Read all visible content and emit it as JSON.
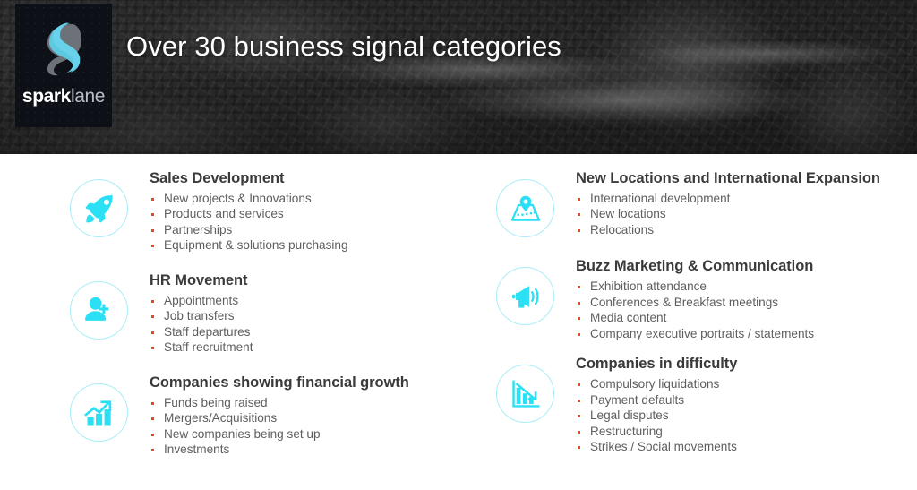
{
  "header": {
    "title": "Over 30 business signal categories",
    "logo": {
      "mark": "spark-s-monogram",
      "word_bold": "spark",
      "word_light": "lane"
    },
    "background_image": "aerial-city-highway-interchange-grayscale"
  },
  "theme": {
    "icon_cyan": "#2BE0F5",
    "icon_circle_border": "#A8EEF8",
    "bullet_marker": "#E8491E",
    "heading_text": "#3A3A3A",
    "body_text": "#5E5E5E",
    "banner_dark": "#0D1117"
  },
  "columns": {
    "left": [
      {
        "icon": "rocket-icon",
        "title": "Sales Development",
        "bullets": [
          "New projects & Innovations",
          "Products and services",
          "Partnerships",
          "Equipment & solutions purchasing"
        ]
      },
      {
        "icon": "user-plus-icon",
        "title": "HR Movement",
        "bullets": [
          "Appointments",
          "Job transfers",
          "Staff departures",
          "Staff recruitment"
        ]
      },
      {
        "icon": "growth-chart-icon",
        "title": "Companies showing financial growth",
        "bullets": [
          "Funds being raised",
          "Mergers/Acquisitions",
          "New companies being set up",
          "Investments"
        ]
      }
    ],
    "right": [
      {
        "icon": "map-pin-icon",
        "title": "New Locations and International Expansion",
        "bullets": [
          "International development",
          "New locations",
          "Relocations"
        ]
      },
      {
        "icon": "megaphone-icon",
        "title": "Buzz Marketing & Communication",
        "bullets": [
          "Exhibition attendance",
          "Conferences & Breakfast meetings",
          "Media content",
          "Company executive portraits / statements"
        ]
      },
      {
        "icon": "decline-chart-icon",
        "title": "Companies in difficulty",
        "bullets": [
          "Compulsory liquidations",
          "Payment defaults",
          "Legal disputes",
          "Restructuring",
          "Strikes / Social movements"
        ]
      }
    ]
  }
}
